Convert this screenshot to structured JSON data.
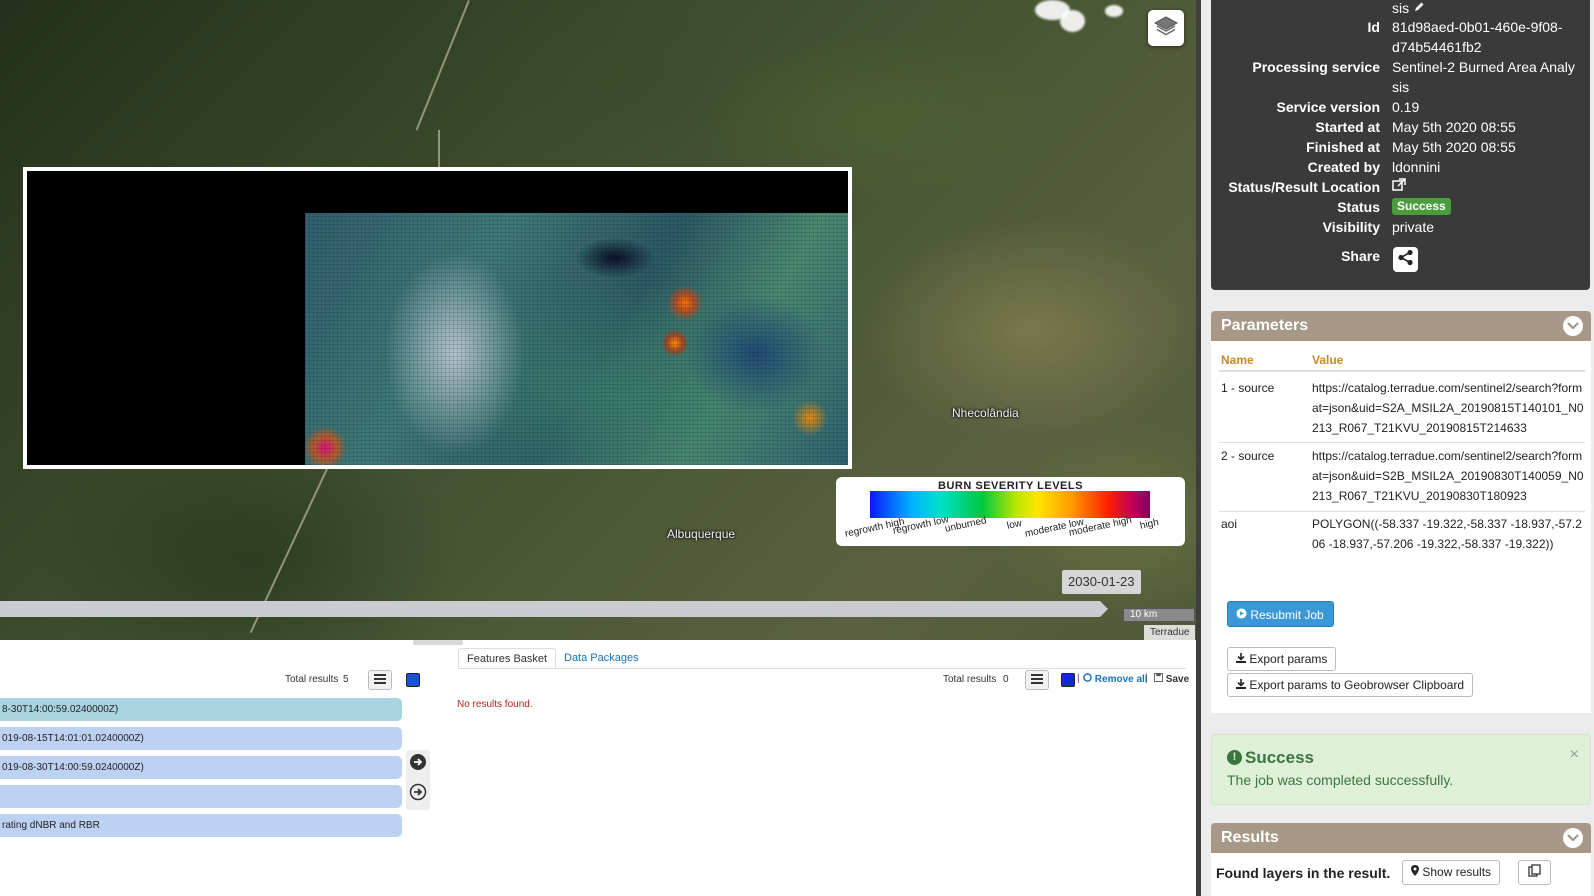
{
  "map": {
    "places": [
      "Nhecolândia",
      "Albuquerque"
    ],
    "legend": {
      "title": "BURN SEVERITY LEVELS",
      "ticks": [
        "regrowth high",
        "regrowth low",
        "unburned",
        "low",
        "moderate low",
        "moderate high",
        "high"
      ]
    },
    "timeline": {
      "date": "2030-01-23"
    },
    "scale": "10 km",
    "attribution": "Terradue",
    "icons": {
      "layers": "layers-icon"
    }
  },
  "results_list": {
    "total_label": "Total results",
    "total": "5",
    "items": [
      {
        "text": "8-30T14:00:59.0240000Z)",
        "color": "#a8d4e2"
      },
      {
        "text": "019-08-15T14:01:01.0240000Z)",
        "color": "#bdd2f2"
      },
      {
        "text": "019-08-30T14:00:59.0240000Z)",
        "color": "#bdd2f2"
      },
      {
        "text": "",
        "color": "#bdd2f2"
      },
      {
        "text": "rating dNBR and RBR",
        "color": "#bdd2f2"
      }
    ]
  },
  "basket": {
    "tabs": [
      "Features Basket",
      "Data Packages"
    ],
    "total_label": "Total results",
    "total": "0",
    "remove_all": "Remove all",
    "save": "Save",
    "separator": "|",
    "empty": "No results found."
  },
  "job": {
    "title_tail": "sis",
    "fields": [
      {
        "label": "Id",
        "value": "81d98aed-0b01-460e-9f08-d74b54461fb2"
      },
      {
        "label": "Processing service",
        "value": "Sentinel-2 Burned Area Analy sis"
      },
      {
        "label": "Service version",
        "value": "0.19"
      },
      {
        "label": "Started at",
        "value": "May 5th 2020 08:55"
      },
      {
        "label": "Finished at",
        "value": "May 5th 2020 08:55"
      },
      {
        "label": "Created by",
        "value": "ldonnini"
      }
    ],
    "status_location_label": "Status/Result Location",
    "status_label": "Status",
    "status": "Success",
    "status_color": "#4a9d3b",
    "visibility_label": "Visibility",
    "visibility": "private",
    "share_label": "Share"
  },
  "parameters": {
    "header": "Parameters",
    "col_name": "Name",
    "col_value": "Value",
    "rows": [
      {
        "name": "1 - source",
        "value": "https://catalog.terradue.com/sentinel2/search?format=json&uid=S2A_MSIL2A_20190815T140101_N0213_R067_T21KVU_20190815T214633"
      },
      {
        "name": "2 - source",
        "value": "https://catalog.terradue.com/sentinel2/search?format=json&uid=S2B_MSIL2A_20190830T140059_N0213_R067_T21KVU_20190830T180923"
      },
      {
        "name": "aoi",
        "value": "POLYGON((-58.337 -19.322,-58.337 -18.937,-57.206 -18.937,-57.206 -19.322,-58.337 -19.322))"
      }
    ],
    "resubmit": "Resubmit Job",
    "export_params": "Export params",
    "export_clipboard": "Export params to Geobrowser Clipboard"
  },
  "alert": {
    "title": "Success",
    "text": "The job was completed successfully.",
    "close": "×"
  },
  "results": {
    "header": "Results",
    "found": "Found layers in the result.",
    "show": "Show results"
  },
  "colors": {
    "panel_header": "#a89888",
    "info_bg": "#3a3a3a",
    "link": "#1a73b8",
    "resubmit": "#3a98d8",
    "alert_bg": "#dff0d8"
  }
}
